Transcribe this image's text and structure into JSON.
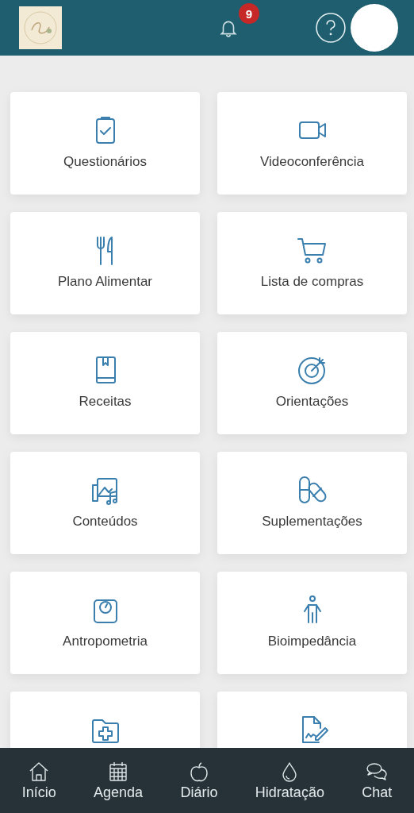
{
  "header": {
    "notification_count": "9"
  },
  "cards": [
    {
      "kind": "labeled",
      "label": "Questionários"
    },
    {
      "kind": "labeled",
      "label": "Videoconferência"
    },
    {
      "kind": "labeled",
      "label": "Plano Alimentar"
    },
    {
      "kind": "labeled",
      "label": "Lista de compras"
    },
    {
      "kind": "labeled",
      "label": "Receitas"
    },
    {
      "kind": "labeled",
      "label": "Orientações"
    },
    {
      "kind": "labeled",
      "label": "Conteúdos"
    },
    {
      "kind": "labeled",
      "label": "Suplementações"
    },
    {
      "kind": "labeled",
      "label": "Antropometria"
    },
    {
      "kind": "labeled",
      "label": "Bioimpedância"
    },
    {
      "kind": "icon_only"
    },
    {
      "kind": "icon_only"
    }
  ],
  "bottom_nav": [
    {
      "label": "Início"
    },
    {
      "label": "Agenda"
    },
    {
      "label": "Diário"
    },
    {
      "label": "Hidratação"
    },
    {
      "label": "Chat"
    }
  ]
}
